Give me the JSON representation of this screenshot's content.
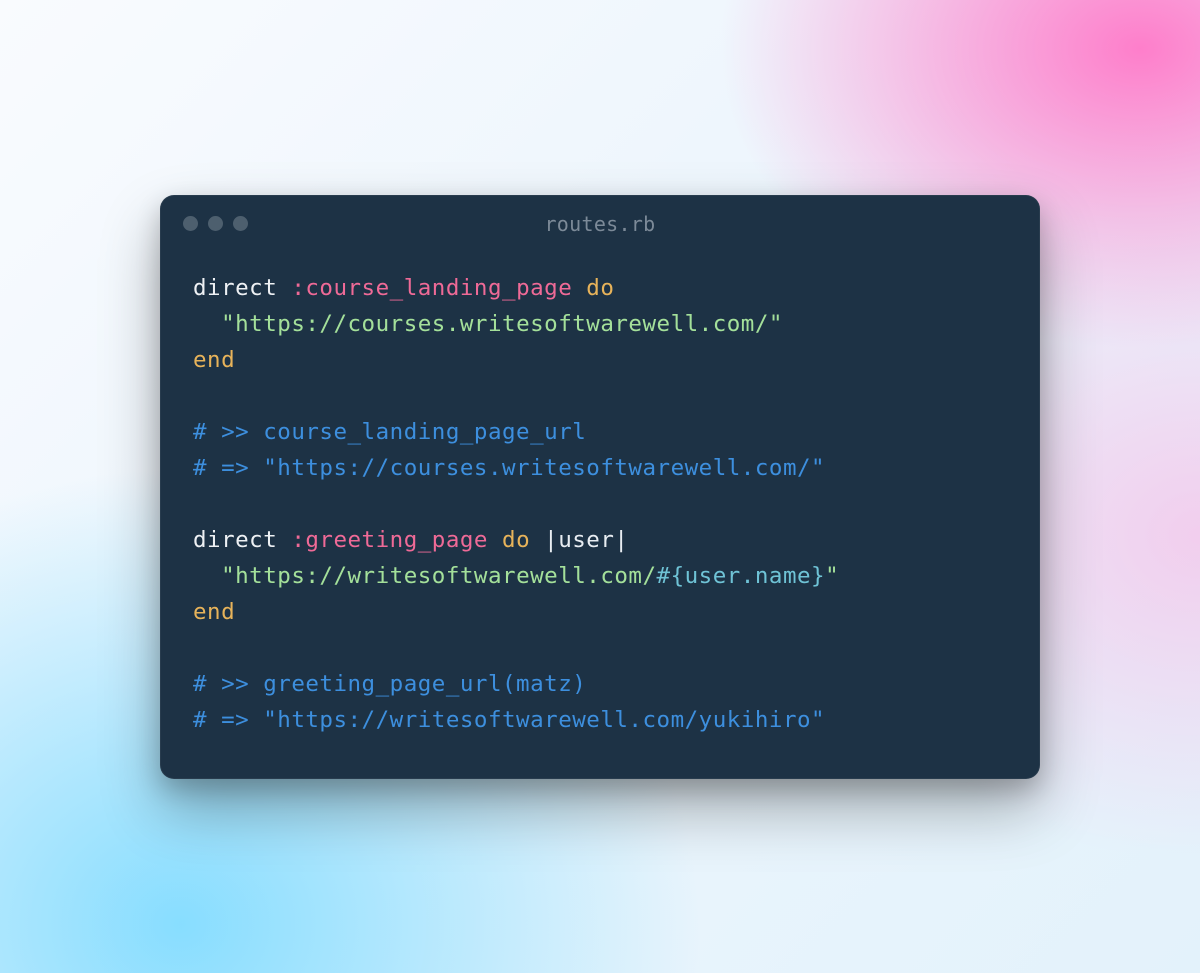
{
  "titlebar": {
    "filename": "routes.rb"
  },
  "code": {
    "l1": {
      "direct": "direct ",
      "sym": ":course_landing_page",
      "do": " do"
    },
    "l2": {
      "indent": "  ",
      "str": "\"https://courses.writesoftwarewell.com/\""
    },
    "l3": {
      "end": "end"
    },
    "l4": "",
    "l5": {
      "comment": "# >> course_landing_page_url"
    },
    "l6": {
      "comment": "# => \"https://courses.writesoftwarewell.com/\""
    },
    "l7": "",
    "l8": {
      "direct": "direct ",
      "sym": ":greeting_page",
      "do": " do ",
      "pipe": "|user|"
    },
    "l9": {
      "indent": "  ",
      "str1": "\"https://writesoftwarewell.com/",
      "interp": "#{user.name}",
      "str2": "\""
    },
    "l10": {
      "end": "end"
    },
    "l11": "",
    "l12": {
      "comment": "# >> greeting_page_url(matz)"
    },
    "l13": {
      "comment": "# => \"https://writesoftwarewell.com/yukihiro\""
    }
  }
}
